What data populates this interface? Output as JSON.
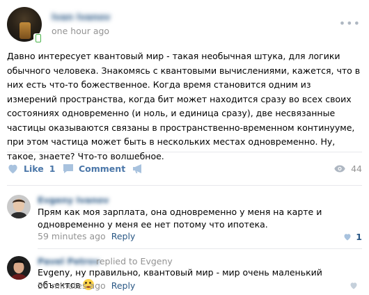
{
  "post": {
    "author": "Ivan Ivanov",
    "time": "one hour ago",
    "text": "Давно интересует квантовый мир - такая необычная штука, для логики обычного человека. Знакомясь с квантовыми вычислениями, кажется, что в них есть что-то божественное. Когда время становится одним из измерений пространства, когда бит может находится сразу во всех своих состояниях одновременно (и ноль, и единица сразу), две несвязанные частицы оказываются связаны в пространственно-временном континууме, при этом частица может быть в нескольких местах одновременно. Ну, такое, знаете? Что-то волшебное.",
    "like_label": "Like",
    "like_count": "1",
    "comment_label": "Comment",
    "views": "44",
    "menu_icon": "more-dots-icon"
  },
  "comments": [
    {
      "author": "Evgeny Ivanov",
      "text": "Прям как моя зарплата, она одновременно у меня на карте и одновременно у меня ее нет потому что ипотека.",
      "time": "59 minutes ago",
      "reply_label": "Reply",
      "likes": "1"
    },
    {
      "author": "Pavel Petrov",
      "replied_to": "replied to Evgeny",
      "text": "Evgeny, ну правильно, квантовый мир - мир очень маленький объектов",
      "time": "55 minutes ago",
      "reply_label": "Reply",
      "likes": ""
    }
  ],
  "colors": {
    "link": "#2a5885",
    "action": "#4a76a8",
    "muted": "#939393",
    "icon": "#aeb7c2",
    "divider": "#e7e8ec"
  }
}
